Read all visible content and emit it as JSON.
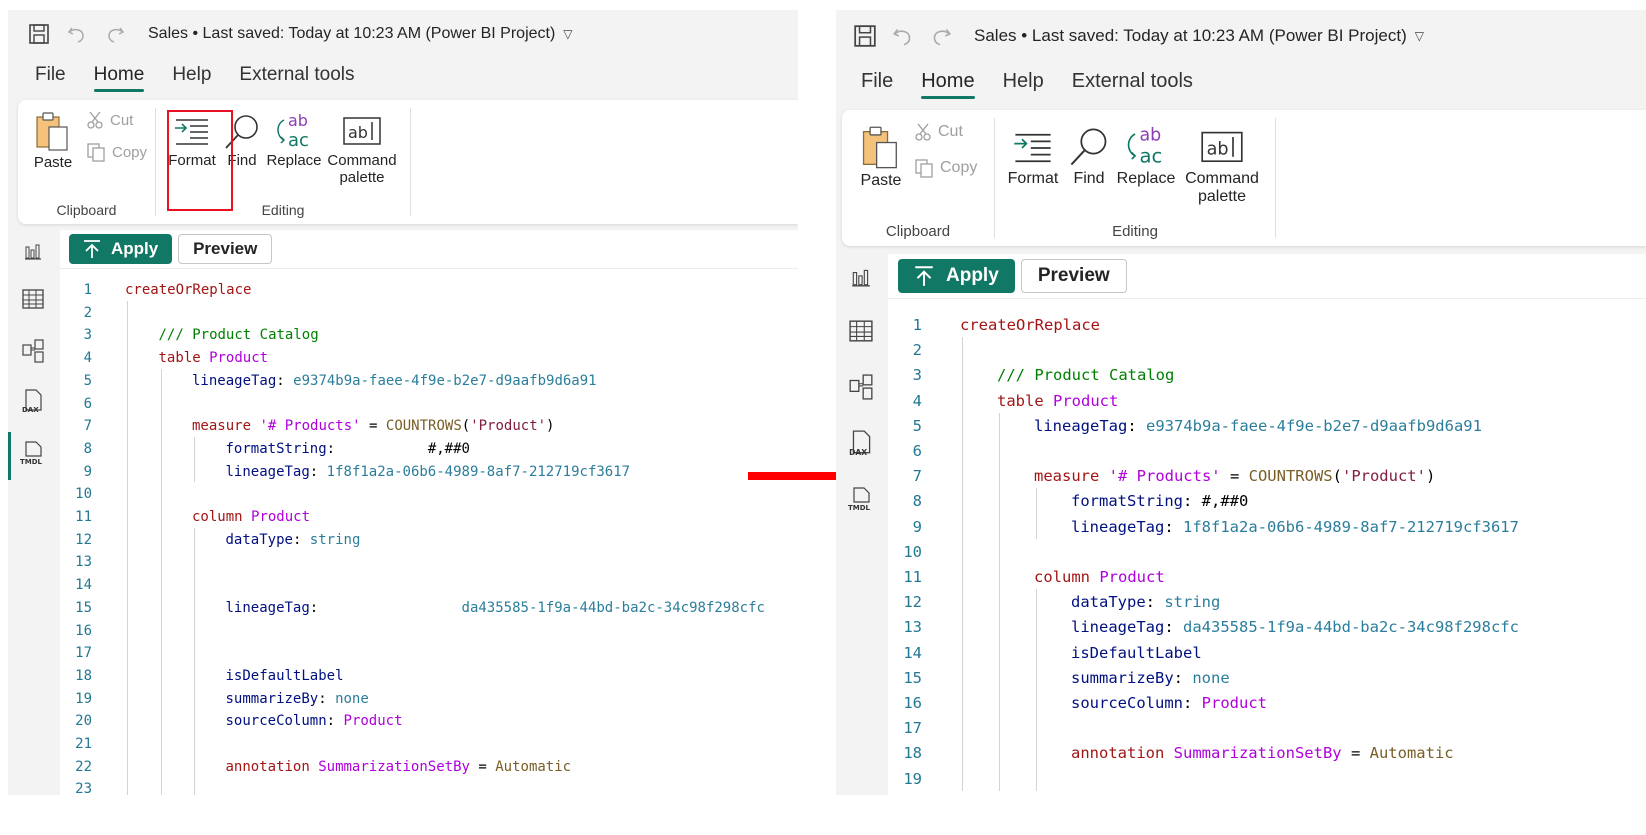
{
  "left": {
    "title": "Sales • Last saved: Today at 10:23 AM (Power BI Project)",
    "menu": [
      "File",
      "Home",
      "Help",
      "External tools"
    ],
    "ribbon": {
      "paste": "Paste",
      "cut": "Cut",
      "copy": "Copy",
      "format": "Format",
      "find": "Find",
      "replace": "Replace",
      "command_line1": "Command",
      "command_line2": "palette",
      "clipboard_group": "Clipboard",
      "editing_group": "Editing"
    },
    "apply": "Apply",
    "preview": "Preview",
    "lines": [
      {
        "n": "1",
        "indent": 0,
        "tokens": [
          [
            "createOrReplace",
            "kw"
          ]
        ]
      },
      {
        "n": "2",
        "indent": 0,
        "tokens": []
      },
      {
        "n": "3",
        "indent": 1,
        "tokens": [
          [
            "/// Product Catalog",
            "cmt"
          ]
        ]
      },
      {
        "n": "4",
        "indent": 1,
        "tokens": [
          [
            "table ",
            "kw"
          ],
          [
            "Product",
            "ent"
          ]
        ]
      },
      {
        "n": "5",
        "indent": 2,
        "tokens": [
          [
            "lineageTag",
            "prop"
          ],
          [
            ": ",
            "op"
          ],
          [
            "e9374b9a-faee-4f9e-b2e7-d9aafb9d6a91",
            "val"
          ]
        ]
      },
      {
        "n": "6",
        "indent": 0,
        "tokens": []
      },
      {
        "n": "7",
        "indent": 2,
        "tokens": [
          [
            "measure ",
            "kw"
          ],
          [
            "'# Products'",
            "ent"
          ],
          [
            " = ",
            "op"
          ],
          [
            "COUNTROWS",
            "fn"
          ],
          [
            "(",
            "op"
          ],
          [
            "'Product'",
            "str2"
          ],
          [
            ")",
            "op"
          ]
        ]
      },
      {
        "n": "8",
        "indent": 3,
        "tokens": [
          [
            "formatString",
            "prop"
          ],
          [
            ":           ",
            "op"
          ],
          [
            "#,##0",
            "plain"
          ]
        ]
      },
      {
        "n": "9",
        "indent": 3,
        "tokens": [
          [
            "lineageTag",
            "prop"
          ],
          [
            ": ",
            "op"
          ],
          [
            "1f8f1a2a-06b6-4989-8af7-212719cf3617",
            "val"
          ]
        ]
      },
      {
        "n": "10",
        "indent": 0,
        "tokens": []
      },
      {
        "n": "11",
        "indent": 2,
        "tokens": [
          [
            "column ",
            "kw"
          ],
          [
            "Product",
            "ent"
          ]
        ]
      },
      {
        "n": "12",
        "indent": 3,
        "tokens": [
          [
            "dataType",
            "prop"
          ],
          [
            ": ",
            "op"
          ],
          [
            "string",
            "val"
          ]
        ]
      },
      {
        "n": "13",
        "indent": 0,
        "tokens": []
      },
      {
        "n": "14",
        "indent": 0,
        "tokens": []
      },
      {
        "n": "15",
        "indent": 3,
        "tokens": [
          [
            "lineageTag",
            "prop"
          ],
          [
            ":                 ",
            "op"
          ],
          [
            "da435585-1f9a-44bd-ba2c-34c98f298cfc",
            "val"
          ]
        ]
      },
      {
        "n": "16",
        "indent": 0,
        "tokens": []
      },
      {
        "n": "17",
        "indent": 0,
        "tokens": []
      },
      {
        "n": "18",
        "indent": 3,
        "tokens": [
          [
            "isDefaultLabel",
            "prop"
          ]
        ]
      },
      {
        "n": "19",
        "indent": 3,
        "tokens": [
          [
            "summarizeBy",
            "prop"
          ],
          [
            ": ",
            "op"
          ],
          [
            "none",
            "val"
          ]
        ]
      },
      {
        "n": "20",
        "indent": 3,
        "tokens": [
          [
            "sourceColumn",
            "prop"
          ],
          [
            ": ",
            "op"
          ],
          [
            "Product",
            "ent"
          ]
        ]
      },
      {
        "n": "21",
        "indent": 0,
        "tokens": []
      },
      {
        "n": "22",
        "indent": 3,
        "tokens": [
          [
            "annotation ",
            "kw"
          ],
          [
            "SummarizationSetBy",
            "ent"
          ],
          [
            " = ",
            "op"
          ],
          [
            "Automatic",
            "fn"
          ]
        ]
      },
      {
        "n": "23",
        "indent": 0,
        "tokens": []
      }
    ]
  },
  "right": {
    "title": "Sales • Last saved: Today at 10:23 AM (Power BI Project)",
    "menu": [
      "File",
      "Home",
      "Help",
      "External tools"
    ],
    "ribbon": {
      "paste": "Paste",
      "cut": "Cut",
      "copy": "Copy",
      "format": "Format",
      "find": "Find",
      "replace": "Replace",
      "command_line1": "Command",
      "command_line2": "palette",
      "clipboard_group": "Clipboard",
      "editing_group": "Editing"
    },
    "apply": "Apply",
    "preview": "Preview",
    "lines": [
      {
        "n": "1",
        "indent": 0,
        "tokens": [
          [
            "createOrReplace",
            "kw"
          ]
        ]
      },
      {
        "n": "2",
        "indent": 0,
        "tokens": []
      },
      {
        "n": "3",
        "indent": 1,
        "tokens": [
          [
            "/// Product Catalog",
            "cmt"
          ]
        ]
      },
      {
        "n": "4",
        "indent": 1,
        "tokens": [
          [
            "table ",
            "kw"
          ],
          [
            "Product",
            "ent"
          ]
        ]
      },
      {
        "n": "5",
        "indent": 2,
        "tokens": [
          [
            "lineageTag",
            "prop"
          ],
          [
            ": ",
            "op"
          ],
          [
            "e9374b9a-faee-4f9e-b2e7-d9aafb9d6a91",
            "val"
          ]
        ]
      },
      {
        "n": "6",
        "indent": 0,
        "tokens": []
      },
      {
        "n": "7",
        "indent": 2,
        "tokens": [
          [
            "measure ",
            "kw"
          ],
          [
            "'# Products'",
            "ent"
          ],
          [
            " = ",
            "op"
          ],
          [
            "COUNTROWS",
            "fn"
          ],
          [
            "(",
            "op"
          ],
          [
            "'Product'",
            "str2"
          ],
          [
            ")",
            "op"
          ]
        ]
      },
      {
        "n": "8",
        "indent": 3,
        "tokens": [
          [
            "formatString",
            "prop"
          ],
          [
            ": ",
            "op"
          ],
          [
            "#,##0",
            "plain"
          ]
        ]
      },
      {
        "n": "9",
        "indent": 3,
        "tokens": [
          [
            "lineageTag",
            "prop"
          ],
          [
            ": ",
            "op"
          ],
          [
            "1f8f1a2a-06b6-4989-8af7-212719cf3617",
            "val"
          ]
        ]
      },
      {
        "n": "10",
        "indent": 0,
        "tokens": []
      },
      {
        "n": "11",
        "indent": 2,
        "tokens": [
          [
            "column ",
            "kw"
          ],
          [
            "Product",
            "ent"
          ]
        ]
      },
      {
        "n": "12",
        "indent": 3,
        "tokens": [
          [
            "dataType",
            "prop"
          ],
          [
            ": ",
            "op"
          ],
          [
            "string",
            "val"
          ]
        ]
      },
      {
        "n": "13",
        "indent": 3,
        "tokens": [
          [
            "lineageTag",
            "prop"
          ],
          [
            ": ",
            "op"
          ],
          [
            "da435585-1f9a-44bd-ba2c-34c98f298cfc",
            "val"
          ]
        ]
      },
      {
        "n": "14",
        "indent": 3,
        "tokens": [
          [
            "isDefaultLabel",
            "prop"
          ]
        ]
      },
      {
        "n": "15",
        "indent": 3,
        "tokens": [
          [
            "summarizeBy",
            "prop"
          ],
          [
            ": ",
            "op"
          ],
          [
            "none",
            "val"
          ]
        ]
      },
      {
        "n": "16",
        "indent": 3,
        "tokens": [
          [
            "sourceColumn",
            "prop"
          ],
          [
            ": ",
            "op"
          ],
          [
            "Product",
            "ent"
          ]
        ]
      },
      {
        "n": "17",
        "indent": 0,
        "tokens": []
      },
      {
        "n": "18",
        "indent": 3,
        "tokens": [
          [
            "annotation ",
            "kw"
          ],
          [
            "SummarizationSetBy",
            "ent"
          ],
          [
            " = ",
            "op"
          ],
          [
            "Automatic",
            "fn"
          ]
        ]
      },
      {
        "n": "19",
        "indent": 0,
        "tokens": []
      }
    ]
  },
  "icons": [
    "save-icon",
    "undo-icon",
    "redo-icon",
    "caret-down-icon",
    "paste-icon",
    "cut-icon",
    "copy-icon",
    "format-icon",
    "find-icon",
    "replace-icon",
    "command-palette-icon",
    "report-view-icon",
    "table-view-icon",
    "model-view-icon",
    "dax-query-icon",
    "tmdl-view-icon",
    "apply-icon",
    "arrow-right-icon"
  ],
  "colors": {
    "accent": "#117865",
    "highlight": "#e81123",
    "arrow": "#ff0000"
  }
}
